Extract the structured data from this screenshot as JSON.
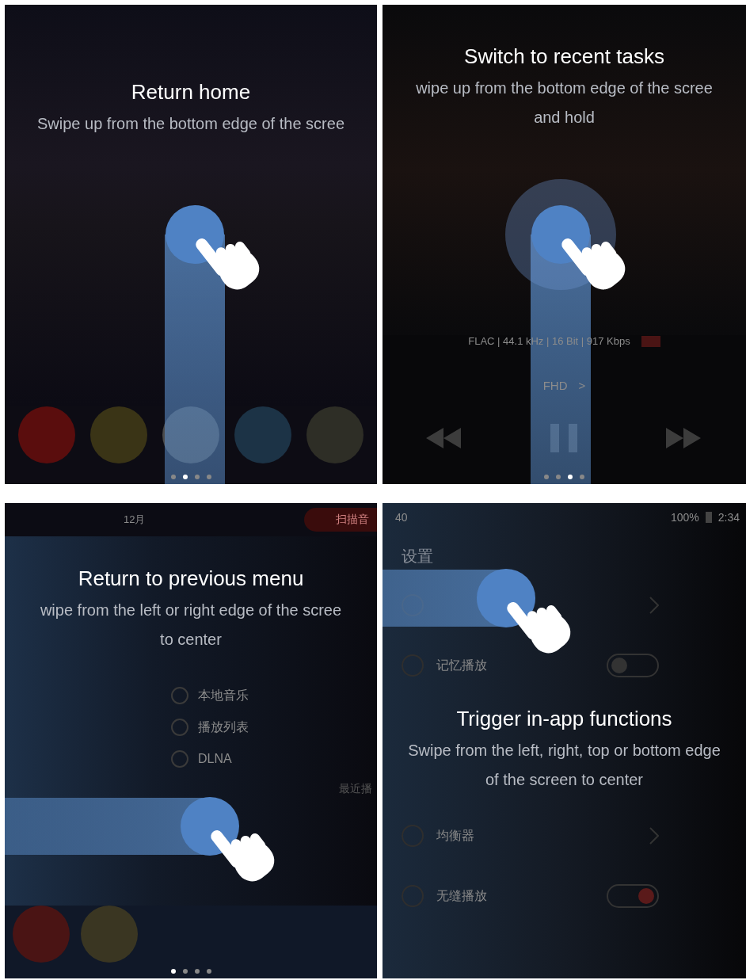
{
  "panels": [
    {
      "kind": "home",
      "title": "Return home",
      "description": [
        "Swipe up from the bottom edge of the scree"
      ],
      "gesture": {
        "kind": "vertical",
        "hold": false
      },
      "dots": [
        {
          "selected": false
        },
        {
          "selected": true
        },
        {
          "selected": false
        },
        {
          "selected": false
        }
      ]
    },
    {
      "kind": "player",
      "title": "Switch to recent tasks",
      "description": [
        "wipe up from the bottom edge of the scree",
        "and hold"
      ],
      "gesture": {
        "kind": "vertical",
        "hold": true
      },
      "audio_info": "FLAC | 44.1 kHz | 16 Bit | 917 Kbps",
      "quality": "FHD",
      "quality_arrow": ">",
      "dots": [
        {
          "selected": false
        },
        {
          "selected": false
        },
        {
          "selected": true
        },
        {
          "selected": false
        }
      ]
    },
    {
      "kind": "menu",
      "title": "Return to previous menu",
      "description": [
        "wipe from the left or right edge of the scree",
        "to center"
      ],
      "gesture": {
        "kind": "horizontal",
        "hold": false
      },
      "date": "12月",
      "scan_button": "扫描音",
      "menu_items": [
        "本地音乐",
        "播放列表",
        "DLNA"
      ],
      "recent": "最近播",
      "dots": [
        {
          "selected": true
        },
        {
          "selected": false
        },
        {
          "selected": false
        },
        {
          "selected": false
        }
      ]
    },
    {
      "kind": "settings",
      "title": "Trigger in-app functions",
      "description": [
        "Swipe from the left, right, top or bottom edge",
        "of the screen to center"
      ],
      "gesture": {
        "kind": "horizontal",
        "hold": false
      },
      "volume": "40",
      "battery": "100%",
      "time": "2:34",
      "screen_title": "设置",
      "settings": [
        {
          "kind": "link"
        },
        {
          "kind": "toggle",
          "label": "记忆播放",
          "on": false
        },
        {
          "kind": "link",
          "label": "均衡器"
        },
        {
          "kind": "toggle",
          "label": "无缝播放",
          "on": true
        }
      ]
    }
  ]
}
